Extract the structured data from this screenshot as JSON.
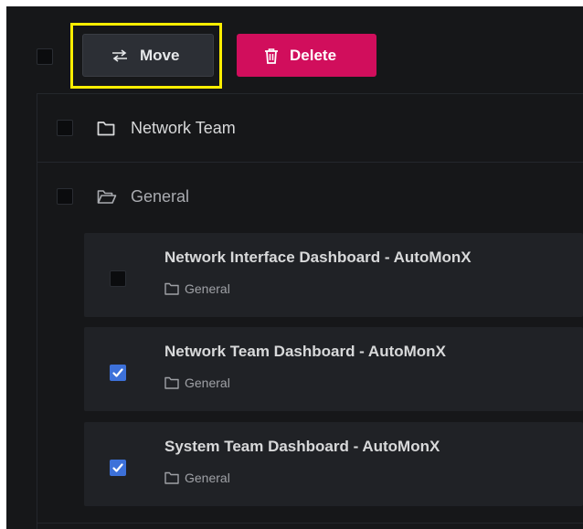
{
  "toolbar": {
    "move_label": "Move",
    "delete_label": "Delete"
  },
  "folders": [
    {
      "name": "Network Team",
      "expanded": false
    },
    {
      "name": "General",
      "expanded": true
    }
  ],
  "dashboards": [
    {
      "title": "Network Interface Dashboard - AutoMonX",
      "folder": "General",
      "checked": false
    },
    {
      "title": "Network Team Dashboard - AutoMonX",
      "folder": "General",
      "checked": true
    },
    {
      "title": "System Team Dashboard - AutoMonX",
      "folder": "General",
      "checked": true
    }
  ],
  "colors": {
    "background": "#161719",
    "card": "#202226",
    "move_button": "#2c2f35",
    "delete_button": "#d10e5c",
    "highlight": "#ffee00",
    "checkbox_checked": "#3d71d9"
  }
}
